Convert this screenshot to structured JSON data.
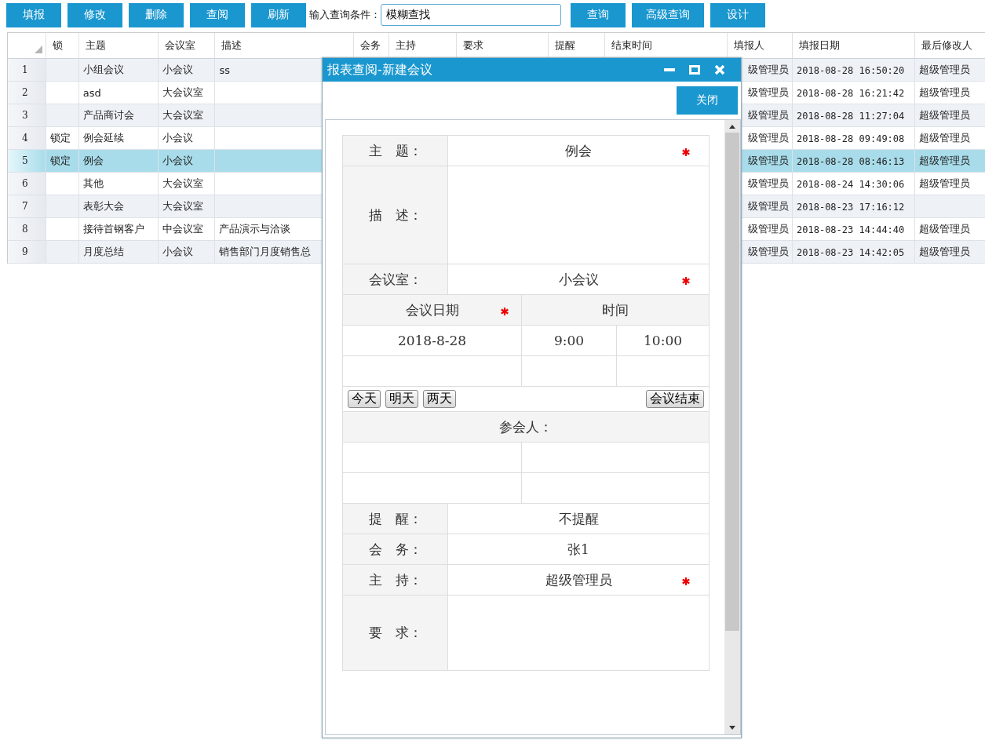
{
  "toolbar": {
    "left_buttons": [
      "填报",
      "修改",
      "删除",
      "查阅",
      "刷新"
    ],
    "query_label": "输入查询条件：",
    "search": {
      "value": "模糊查找"
    },
    "right_buttons": [
      "查询",
      "高级查询",
      "设计"
    ]
  },
  "table": {
    "columns": [
      "锁",
      "主题",
      "会议室",
      "描述",
      "会务",
      "主持",
      "要求",
      "提醒",
      "结束时间",
      "填报人",
      "填报日期",
      "最后修改人"
    ],
    "rows": [
      {
        "number": "1",
        "lock": "",
        "subject": "小组会议",
        "room": "小会议",
        "description": "ss",
        "reporter": "级管理员",
        "report_date": "2018-08-28 16:50:20",
        "modifier": "超级管理员",
        "selected": false
      },
      {
        "number": "2",
        "lock": "",
        "subject": "asd",
        "room": "大会议室",
        "description": "",
        "reporter": "级管理员",
        "report_date": "2018-08-28 16:21:42",
        "modifier": "超级管理员",
        "selected": false
      },
      {
        "number": "3",
        "lock": "",
        "subject": "产品商讨会",
        "room": "大会议室",
        "description": "",
        "reporter": "级管理员",
        "report_date": "2018-08-28 11:27:04",
        "modifier": "超级管理员",
        "selected": false
      },
      {
        "number": "4",
        "lock": "锁定",
        "subject": "例会延续",
        "room": "小会议",
        "description": "",
        "reporter": "级管理员",
        "report_date": "2018-08-28 09:49:08",
        "modifier": "超级管理员",
        "selected": false
      },
      {
        "number": "5",
        "lock": "锁定",
        "subject": "例会",
        "room": "小会议",
        "description": "",
        "reporter": "级管理员",
        "report_date": "2018-08-28 08:46:13",
        "modifier": "超级管理员",
        "selected": true
      },
      {
        "number": "6",
        "lock": "",
        "subject": "其他",
        "room": "大会议室",
        "description": "",
        "reporter": "级管理员",
        "report_date": "2018-08-24 14:30:06",
        "modifier": "超级管理员",
        "selected": false
      },
      {
        "number": "7",
        "lock": "",
        "subject": "表彰大会",
        "room": "大会议室",
        "description": "",
        "reporter": "级管理员",
        "report_date": "2018-08-23 17:16:12",
        "modifier": "",
        "selected": false
      },
      {
        "number": "8",
        "lock": "",
        "subject": "接待首钢客户",
        "room": "中会议室",
        "description": "产品演示与洽谈",
        "reporter": "级管理员",
        "report_date": "2018-08-23 14:44:40",
        "modifier": "超级管理员",
        "selected": false
      },
      {
        "number": "9",
        "lock": "",
        "subject": "月度总结",
        "room": "小会议",
        "description": "销售部门月度销售总",
        "reporter": "级管理员",
        "report_date": "2018-08-23 14:42:05",
        "modifier": "超级管理员",
        "selected": false
      }
    ]
  },
  "dialog": {
    "title": "报表查阅-新建会议",
    "close_button": "关闭",
    "form": {
      "subject": {
        "label": "主　题：",
        "value": "例会",
        "required": true
      },
      "description": {
        "label": "描　述："
      },
      "room": {
        "label": "会议室：",
        "value": "小会议",
        "required": true
      },
      "date_header": {
        "label": "会议日期",
        "required": true
      },
      "time_header": "时间",
      "date": "2018-8-28",
      "start_time": "9:00",
      "end_time": "10:00",
      "quick_buttons": [
        "今天",
        "明天",
        "两天"
      ],
      "end_button": "会议结束",
      "attendees_label": "参会人：",
      "reminder": {
        "label": "提　醒：",
        "value": "不提醒"
      },
      "service": {
        "label": "会　务：",
        "value": "张1"
      },
      "host": {
        "label": "主　持：",
        "value": "超级管理员",
        "required": true
      },
      "requirements": {
        "label": "要　求："
      }
    }
  }
}
